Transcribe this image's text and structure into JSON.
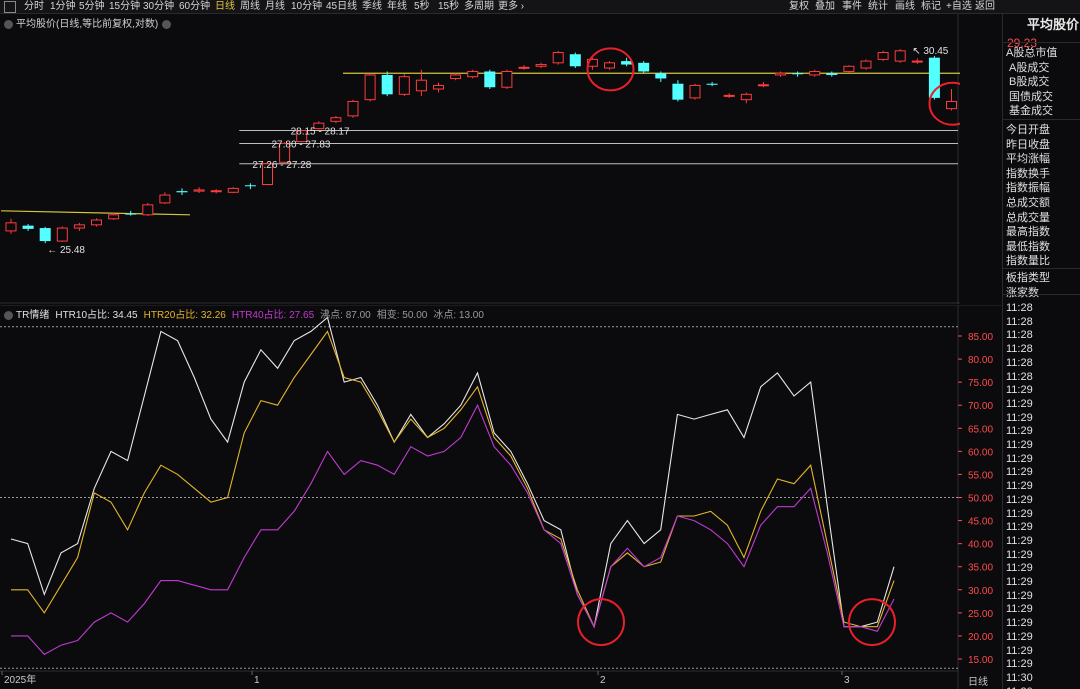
{
  "toolbar": {
    "left_items": [
      "分时",
      "1分钟",
      "5分钟",
      "15分钟",
      "30分钟",
      "60分钟",
      "日线",
      "周线",
      "月线",
      "10分钟",
      "45日线",
      "季线",
      "年线",
      "5秒",
      "15秒",
      "多周期",
      "更多 ›"
    ],
    "active_item": "日线",
    "right_items": [
      "复权",
      "叠加",
      "事件",
      "统计",
      "画线",
      "标记",
      "+自选",
      "返回"
    ]
  },
  "main_chart": {
    "title": "平均股价(日线,等比前复权,对数)",
    "price_axis": [
      "28.74",
      "25.87"
    ],
    "annotations": {
      "high": "30.45",
      "low": "25.48",
      "zones": [
        "28.15 - 28.17",
        "27.80 - 27.83",
        "27.26 - 27.28"
      ]
    },
    "candles": [
      {
        "o": 25.55,
        "c": 25.75,
        "h": 25.85,
        "l": 25.48
      },
      {
        "o": 25.68,
        "c": 25.6,
        "h": 25.72,
        "l": 25.55
      },
      {
        "o": 25.62,
        "c": 25.3,
        "h": 25.65,
        "l": 25.25
      },
      {
        "o": 25.3,
        "c": 25.62,
        "h": 25.66,
        "l": 25.28
      },
      {
        "o": 25.62,
        "c": 25.7,
        "h": 25.75,
        "l": 25.55
      },
      {
        "o": 25.7,
        "c": 25.82,
        "h": 25.86,
        "l": 25.66
      },
      {
        "o": 25.85,
        "c": 25.95,
        "h": 26.0,
        "l": 25.82
      },
      {
        "o": 25.98,
        "c": 25.97,
        "h": 26.05,
        "l": 25.93
      },
      {
        "o": 25.95,
        "c": 26.2,
        "h": 26.25,
        "l": 25.92
      },
      {
        "o": 26.25,
        "c": 26.45,
        "h": 26.52,
        "l": 26.22
      },
      {
        "o": 26.55,
        "c": 26.52,
        "h": 26.62,
        "l": 26.45
      },
      {
        "o": 26.55,
        "c": 26.58,
        "h": 26.65,
        "l": 26.5
      },
      {
        "o": 26.55,
        "c": 26.56,
        "h": 26.6,
        "l": 26.49
      },
      {
        "o": 26.52,
        "c": 26.62,
        "h": 26.65,
        "l": 26.5
      },
      {
        "o": 26.7,
        "c": 26.68,
        "h": 26.75,
        "l": 26.6
      },
      {
        "o": 26.72,
        "c": 27.26,
        "h": 27.28,
        "l": 26.7
      },
      {
        "o": 27.3,
        "c": 27.8,
        "h": 27.83,
        "l": 27.28
      },
      {
        "o": 27.85,
        "c": 28.15,
        "h": 28.17,
        "l": 27.83
      },
      {
        "o": 28.2,
        "c": 28.35,
        "h": 28.4,
        "l": 28.18
      },
      {
        "o": 28.4,
        "c": 28.5,
        "h": 28.55,
        "l": 28.35
      },
      {
        "o": 28.55,
        "c": 28.95,
        "h": 29.0,
        "l": 28.5
      },
      {
        "o": 29.0,
        "c": 29.7,
        "h": 29.75,
        "l": 28.95
      },
      {
        "o": 29.7,
        "c": 29.15,
        "h": 29.8,
        "l": 29.1
      },
      {
        "o": 29.15,
        "c": 29.65,
        "h": 29.72,
        "l": 29.1
      },
      {
        "o": 29.25,
        "c": 29.55,
        "h": 29.85,
        "l": 29.1
      },
      {
        "o": 29.3,
        "c": 29.4,
        "h": 29.48,
        "l": 29.2
      },
      {
        "o": 29.6,
        "c": 29.7,
        "h": 29.75,
        "l": 29.55
      },
      {
        "o": 29.65,
        "c": 29.8,
        "h": 29.85,
        "l": 29.6
      },
      {
        "o": 29.8,
        "c": 29.35,
        "h": 29.85,
        "l": 29.3
      },
      {
        "o": 29.35,
        "c": 29.8,
        "h": 29.85,
        "l": 29.3
      },
      {
        "o": 29.9,
        "c": 29.92,
        "h": 29.98,
        "l": 29.85
      },
      {
        "o": 29.95,
        "c": 30.0,
        "h": 30.05,
        "l": 29.9
      },
      {
        "o": 30.05,
        "c": 30.35,
        "h": 30.4,
        "l": 30.0
      },
      {
        "o": 30.3,
        "c": 29.95,
        "h": 30.35,
        "l": 29.9
      },
      {
        "o": 29.95,
        "c": 30.15,
        "h": 30.2,
        "l": 29.85
      },
      {
        "o": 29.9,
        "c": 30.05,
        "h": 30.1,
        "l": 29.85
      },
      {
        "o": 30.1,
        "c": 30.0,
        "h": 30.2,
        "l": 29.95
      },
      {
        "o": 30.05,
        "c": 29.8,
        "h": 30.1,
        "l": 29.75
      },
      {
        "o": 29.75,
        "c": 29.6,
        "h": 29.8,
        "l": 29.5
      },
      {
        "o": 29.45,
        "c": 29.0,
        "h": 29.55,
        "l": 28.95
      },
      {
        "o": 29.05,
        "c": 29.4,
        "h": 29.45,
        "l": 29.0
      },
      {
        "o": 29.45,
        "c": 29.42,
        "h": 29.5,
        "l": 29.38
      },
      {
        "o": 29.1,
        "c": 29.12,
        "h": 29.18,
        "l": 29.05
      },
      {
        "o": 29.0,
        "c": 29.15,
        "h": 29.2,
        "l": 28.9
      },
      {
        "o": 29.4,
        "c": 29.42,
        "h": 29.5,
        "l": 29.35
      },
      {
        "o": 29.7,
        "c": 29.75,
        "h": 29.8,
        "l": 29.65
      },
      {
        "o": 29.75,
        "c": 29.72,
        "h": 29.8,
        "l": 29.65
      },
      {
        "o": 29.7,
        "c": 29.8,
        "h": 29.85,
        "l": 29.65
      },
      {
        "o": 29.75,
        "c": 29.7,
        "h": 29.8,
        "l": 29.65
      },
      {
        "o": 29.8,
        "c": 29.95,
        "h": 29.98,
        "l": 29.75
      },
      {
        "o": 29.9,
        "c": 30.1,
        "h": 30.15,
        "l": 29.85
      },
      {
        "o": 30.15,
        "c": 30.35,
        "h": 30.4,
        "l": 30.1
      },
      {
        "o": 30.1,
        "c": 30.4,
        "h": 30.45,
        "l": 30.05
      },
      {
        "o": 30.1,
        "c": 30.1,
        "h": 30.18,
        "l": 30.02
      },
      {
        "o": 30.2,
        "c": 29.05,
        "h": 30.25,
        "l": 29.0
      },
      {
        "o": 28.75,
        "c": 28.95,
        "h": 29.3,
        "l": 28.7
      },
      {
        "o": 29.3,
        "c": 29.3,
        "h": 29.38,
        "l": 29.22
      }
    ],
    "trend_lines": [
      {
        "from_index": 0,
        "from_price": 26.05,
        "to_index": 10,
        "to_price": 25.95,
        "color": "#d4c53a"
      },
      {
        "from_index": 20,
        "from_price": 29.75,
        "to_index": 56,
        "to_price": 29.75,
        "color": "#d4c53a"
      }
    ],
    "zone_prices": [
      28.15,
      27.8,
      27.26
    ],
    "circled_candles": [
      35,
      55
    ]
  },
  "indicator": {
    "name": "TR情绪",
    "labels": [
      {
        "text": "HTR10占比: 34.45",
        "color": "#e0e0e0"
      },
      {
        "text": "HTR20占比: 32.26",
        "color": "#e3b52a"
      },
      {
        "text": "HTR40占比: 27.65",
        "color": "#c03ad0"
      },
      {
        "text": "沸点: 87.00",
        "color": "#9a9a9a"
      },
      {
        "text": "相变: 50.00",
        "color": "#9a9a9a"
      },
      {
        "text": "冰点: 13.00",
        "color": "#9a9a9a"
      }
    ],
    "axis_ticks": [
      "85.00",
      "80.00",
      "75.00",
      "70.00",
      "65.00",
      "60.00",
      "55.00",
      "50.00",
      "45.00",
      "40.00",
      "35.00",
      "30.00",
      "25.00",
      "20.00",
      "15.00"
    ],
    "ref_lines": [
      87,
      50,
      13
    ],
    "circled_points": [
      35,
      55
    ],
    "series": [
      {
        "name": "HTR10",
        "color": "#e8e8e8",
        "values": [
          41,
          40,
          29,
          38,
          40,
          52,
          60,
          58,
          72,
          86,
          84,
          76,
          67,
          62,
          75,
          82,
          78,
          84,
          86,
          89,
          75,
          76,
          70,
          62,
          68,
          63,
          66,
          70,
          77,
          64,
          60,
          53,
          45,
          43,
          29,
          22,
          40,
          45,
          40,
          43,
          68,
          67,
          68,
          69,
          63,
          74,
          77,
          72,
          75,
          48,
          22,
          22,
          23,
          35
        ]
      },
      {
        "name": "HTR20",
        "color": "#e3b52a",
        "values": [
          30,
          30,
          25,
          31,
          37,
          51,
          49,
          43,
          51,
          57,
          55,
          52,
          49,
          50,
          64,
          71,
          70,
          76,
          81,
          86,
          76,
          75,
          69,
          62,
          67,
          63,
          65,
          69,
          74,
          63,
          59,
          52,
          43,
          41,
          30,
          22,
          35,
          38,
          35,
          36,
          46,
          46,
          47,
          44,
          37,
          47,
          54,
          53,
          57,
          40,
          23,
          22,
          22,
          32
        ]
      },
      {
        "name": "HTR40",
        "color": "#c03ad0",
        "values": [
          20,
          20,
          16,
          18,
          19,
          23,
          25,
          23,
          27,
          32,
          32,
          31,
          30,
          30,
          37,
          43,
          43,
          47,
          53,
          60,
          55,
          58,
          57,
          55,
          61,
          59,
          60,
          63,
          70,
          61,
          57,
          51,
          43,
          40,
          29,
          22,
          35,
          39,
          35,
          37,
          46,
          45,
          43,
          40,
          35,
          44,
          48,
          48,
          52,
          38,
          22,
          22,
          21,
          28
        ]
      }
    ]
  },
  "x_axis": {
    "labels": [
      "2025年",
      "1",
      "2",
      "3"
    ],
    "label_indices": [
      0,
      14,
      35,
      49
    ],
    "right_label": "日线"
  },
  "side_panel": {
    "title": "平均股价",
    "price": "29.23",
    "items": [
      "A股总市值",
      "A股成交",
      "B股成交",
      "国债成交",
      "基金成交",
      "今日开盘",
      "昨日收盘",
      "平均涨幅",
      "指数换手",
      "指数振幅",
      "总成交额",
      "总成交量",
      "最高指数",
      "最低指数",
      "指数量比",
      "板指类型",
      "涨家数"
    ],
    "times": [
      "11:28",
      "11:28",
      "11:28",
      "11:28",
      "11:28",
      "11:28",
      "11:29",
      "11:29",
      "11:29",
      "11:29",
      "11:29",
      "11:29",
      "11:29",
      "11:29",
      "11:29",
      "11:29",
      "11:29",
      "11:29",
      "11:29",
      "11:29",
      "11:29",
      "11:29",
      "11:29",
      "11:29",
      "11:29",
      "11:29",
      "11:29",
      "11:30",
      "11:30",
      "11:30"
    ]
  }
}
